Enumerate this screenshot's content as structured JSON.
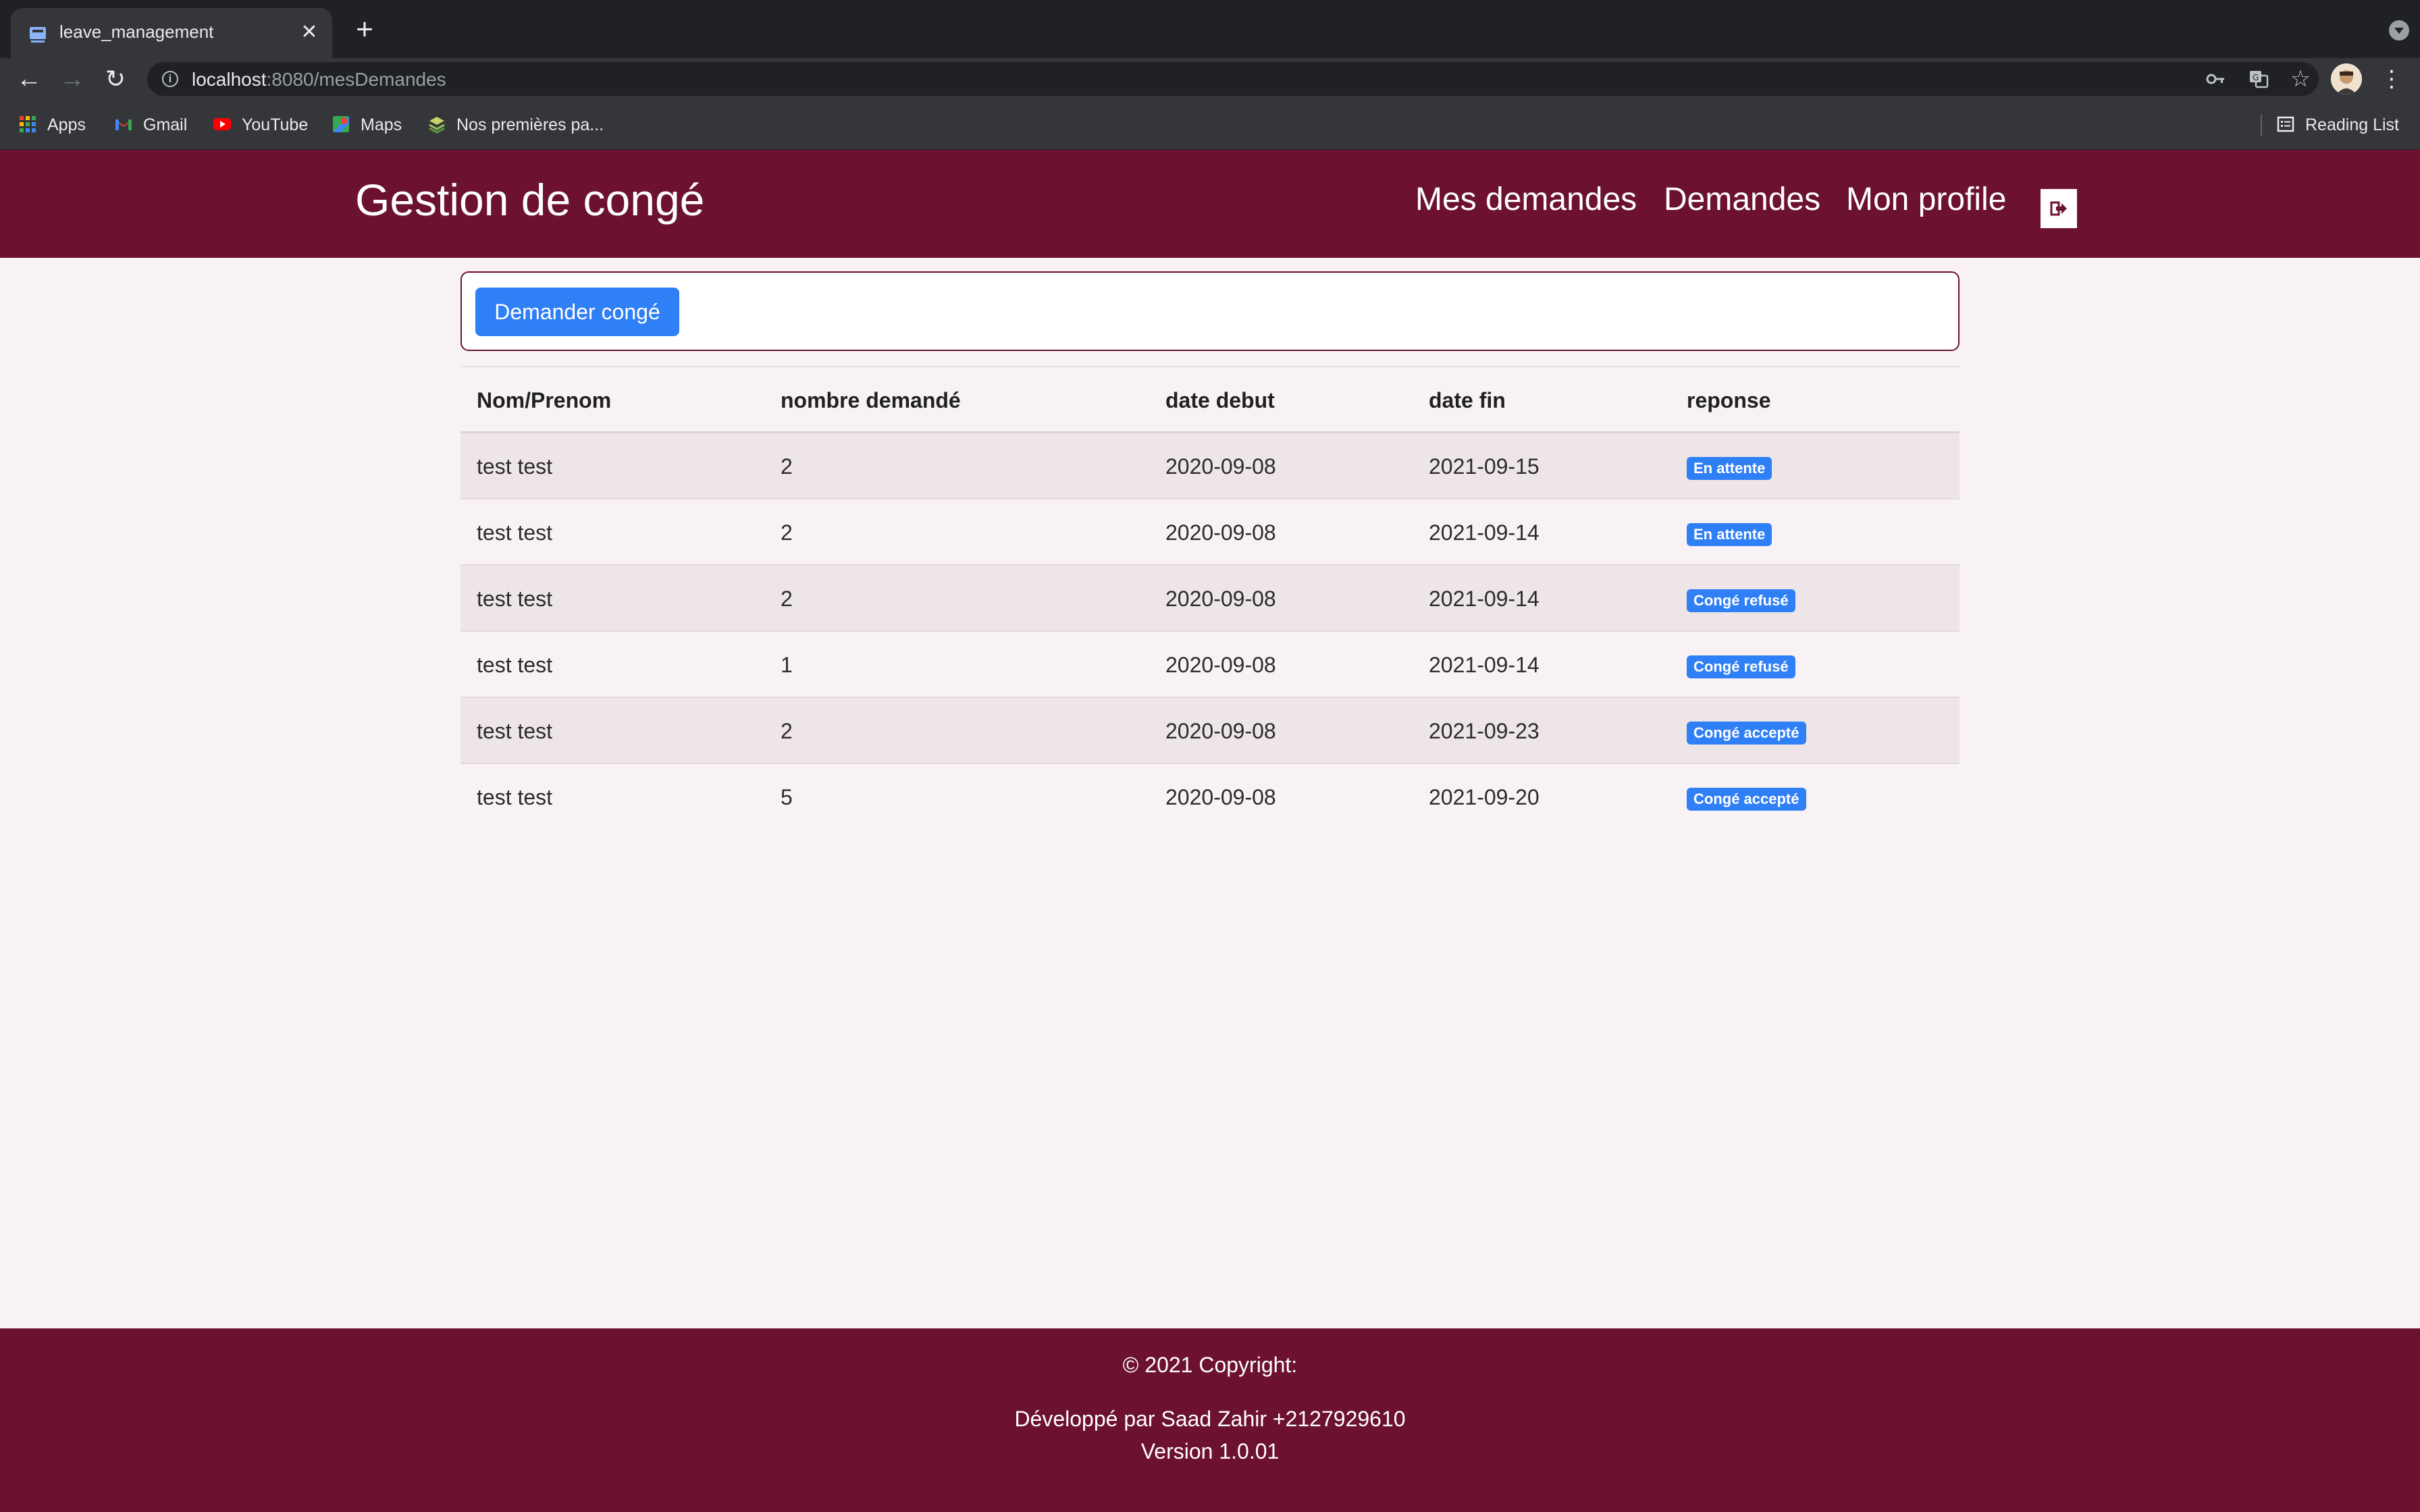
{
  "browser": {
    "tab_title": "leave_management",
    "new_tab_symbol": "+",
    "close_symbol": "✕",
    "url_host": "localhost",
    "url_rest": ":8080/mesDemandes",
    "bookmarks": [
      "Apps",
      "Gmail",
      "YouTube",
      "Maps",
      "Nos premières pa..."
    ],
    "reading_list": "Reading List"
  },
  "header": {
    "brand": "Gestion de congé",
    "nav": [
      "Mes demandes",
      "Demandes",
      "Mon profile"
    ]
  },
  "actions": {
    "request_leave_label": "Demander congé"
  },
  "table": {
    "columns": [
      "Nom/Prenom",
      "nombre demandé",
      "date debut",
      "date fin",
      "reponse"
    ],
    "rows": [
      {
        "name": "test test",
        "count": "2",
        "start": "2020-09-08",
        "end": "2021-09-15",
        "status": "En attente"
      },
      {
        "name": "test test",
        "count": "2",
        "start": "2020-09-08",
        "end": "2021-09-14",
        "status": "En attente"
      },
      {
        "name": "test test",
        "count": "2",
        "start": "2020-09-08",
        "end": "2021-09-14",
        "status": "Congé refusé"
      },
      {
        "name": "test test",
        "count": "1",
        "start": "2020-09-08",
        "end": "2021-09-14",
        "status": "Congé refusé"
      },
      {
        "name": "test test",
        "count": "2",
        "start": "2020-09-08",
        "end": "2021-09-23",
        "status": "Congé accepté"
      },
      {
        "name": "test test",
        "count": "5",
        "start": "2020-09-08",
        "end": "2021-09-20",
        "status": "Congé accepté"
      }
    ]
  },
  "footer": {
    "copyright": "© 2021 Copyright:",
    "developer": "Développé par Saad Zahir +2127929610",
    "version": "Version 1.0.01"
  },
  "colors": {
    "brand": "#6c1230",
    "primary": "#2f7ff6",
    "background": "#f8f2f4"
  }
}
